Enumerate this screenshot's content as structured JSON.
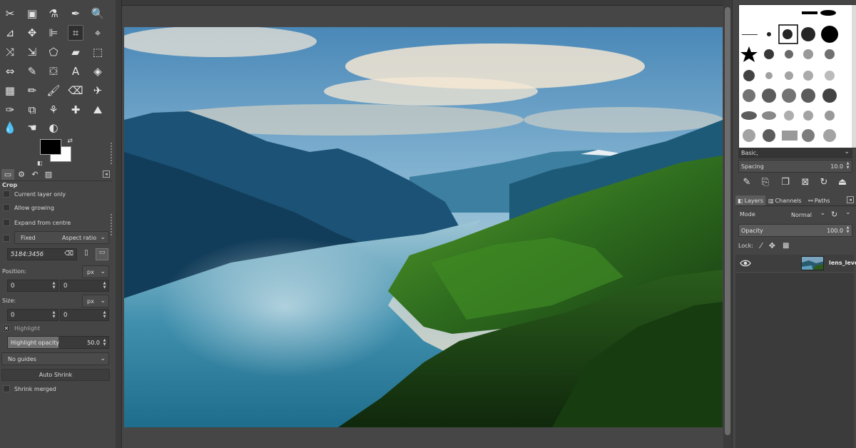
{
  "toolbox": {
    "tools": [
      {
        "name": "scissors-select-icon",
        "glyph": "✂"
      },
      {
        "name": "foreground-select-icon",
        "glyph": "▣"
      },
      {
        "name": "fuzzy-select-icon",
        "glyph": "⚗"
      },
      {
        "name": "color-picker-icon",
        "glyph": "✒"
      },
      {
        "name": "zoom-icon",
        "glyph": "🔍"
      },
      {
        "name": "measure-icon",
        "glyph": "⊿"
      },
      {
        "name": "move-icon",
        "glyph": "✥"
      },
      {
        "name": "align-icon",
        "glyph": "⊫"
      },
      {
        "name": "crop-icon",
        "glyph": "⌗"
      },
      {
        "name": "unified-transform-icon",
        "glyph": "⌖"
      },
      {
        "name": "warp-transform-icon",
        "glyph": "⤨"
      },
      {
        "name": "handle-transform-icon",
        "glyph": "⇲"
      },
      {
        "name": "cage-transform-icon",
        "glyph": "⬠"
      },
      {
        "name": "perspective-icon",
        "glyph": "▰"
      },
      {
        "name": "3d-transform-icon",
        "glyph": "⬚"
      },
      {
        "name": "flip-icon",
        "glyph": "⇔"
      },
      {
        "name": "paths-icon",
        "glyph": "✎"
      },
      {
        "name": "bucket-fill-icon",
        "glyph": "⛋"
      },
      {
        "name": "text-icon",
        "glyph": "A"
      },
      {
        "name": "gradient-icon",
        "glyph": "◈"
      },
      {
        "name": "blend-icon",
        "glyph": "▦"
      },
      {
        "name": "pencil-icon",
        "glyph": "✏"
      },
      {
        "name": "paintbrush-icon",
        "glyph": "🖌"
      },
      {
        "name": "eraser-icon",
        "glyph": "⌫"
      },
      {
        "name": "airbrush-icon",
        "glyph": "✈"
      },
      {
        "name": "ink-icon",
        "glyph": "✑"
      },
      {
        "name": "mypaint-brush-icon",
        "glyph": "⧉"
      },
      {
        "name": "clone-icon",
        "glyph": "⚘"
      },
      {
        "name": "heal-icon",
        "glyph": "✚"
      },
      {
        "name": "perspective-clone-icon",
        "glyph": "⛰"
      },
      {
        "name": "blur-icon",
        "glyph": "💧"
      },
      {
        "name": "smudge-icon",
        "glyph": "☚"
      },
      {
        "name": "dodge-burn-icon",
        "glyph": "◐"
      }
    ],
    "active_tool": "crop-icon"
  },
  "options": {
    "title": "Crop",
    "current_layer_only": "Current layer only",
    "allow_growing": "Allow growing",
    "expand_from_centre": "Expand from centre",
    "fixed_label": "Fixed",
    "fixed_mode": "Aspect ratio",
    "ratio_value": "5184:3456",
    "position_label": "Position:",
    "position_unit": "px",
    "position_x": "0",
    "position_y": "0",
    "size_label": "Size:",
    "size_unit": "px",
    "size_w": "0",
    "size_h": "0",
    "highlight_label": "Highlight",
    "highlight_opacity_label": "Highlight opacity",
    "highlight_opacity_value": "50.0",
    "highlight_opacity_fraction": 0.5,
    "guides": "No guides",
    "auto_shrink": "Auto Shrink",
    "shrink_merged": "Shrink merged"
  },
  "dock": {
    "brush_preset": "Basic,",
    "spacing_label": "Spacing",
    "spacing_value": "10.0",
    "tabs": {
      "layers": "Layers",
      "channels": "Channels",
      "paths": "Paths"
    },
    "mode_label": "Mode",
    "mode_value": "Normal",
    "opacity_label": "Opacity",
    "opacity_value": "100.0",
    "lock_label": "Lock:",
    "layer_name": "lens_level.jpg"
  },
  "colors": {
    "foreground": "#000000",
    "background": "#ffffff",
    "panel": "#454545"
  }
}
